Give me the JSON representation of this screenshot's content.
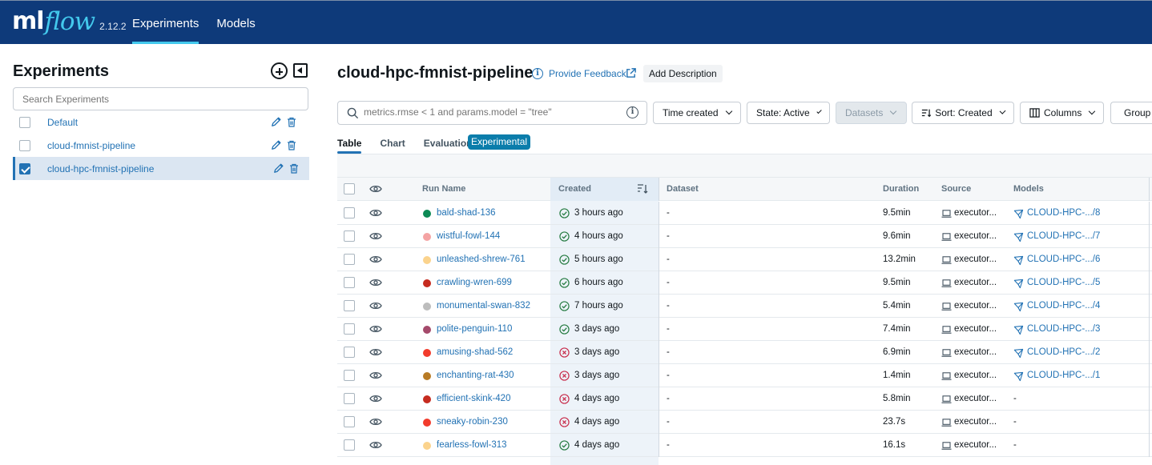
{
  "header": {
    "logo_ml": "ml",
    "logo_flow": "flow",
    "version": "2.12.2",
    "nav": [
      {
        "label": "Experiments",
        "active": true
      },
      {
        "label": "Models",
        "active": false
      }
    ],
    "bg_color": "#0e3a7a",
    "accent_color": "#43c9ed"
  },
  "sidebar": {
    "title": "Experiments",
    "search_placeholder": "Search Experiments",
    "items": [
      {
        "name": "Default",
        "selected": false
      },
      {
        "name": "cloud-fmnist-pipeline",
        "selected": false
      },
      {
        "name": "cloud-hpc-fmnist-pipeline",
        "selected": true
      }
    ]
  },
  "main": {
    "title": "cloud-hpc-fmnist-pipeline",
    "feedback_label": "Provide Feedback",
    "add_description_label": "Add Description",
    "filter_placeholder": "metrics.rmse < 1 and params.model = \"tree\"",
    "toolbar": {
      "time_created": "Time created",
      "state": "State: Active",
      "datasets": "Datasets",
      "sort": "Sort: Created",
      "columns": "Columns",
      "group": "Group"
    },
    "tabs": [
      {
        "label": "Table",
        "active": true
      },
      {
        "label": "Chart",
        "active": false
      },
      {
        "label": "Evaluation",
        "active": false
      }
    ],
    "experimental_badge": "Experimental"
  },
  "table": {
    "columns": {
      "run_name": "Run Name",
      "created": "Created",
      "dataset": "Dataset",
      "duration": "Duration",
      "source": "Source",
      "models": "Models"
    },
    "rows": [
      {
        "name": "bald-shad-136",
        "color": "#0c8a55",
        "status": "finished",
        "created": "3 hours ago",
        "dataset": "-",
        "duration": "9.5min",
        "source": "executor...",
        "model": "CLOUD-HPC-.../8"
      },
      {
        "name": "wistful-fowl-144",
        "color": "#f4a3a3",
        "status": "finished",
        "created": "4 hours ago",
        "dataset": "-",
        "duration": "9.6min",
        "source": "executor...",
        "model": "CLOUD-HPC-.../7"
      },
      {
        "name": "unleashed-shrew-761",
        "color": "#fbd38d",
        "status": "finished",
        "created": "5 hours ago",
        "dataset": "-",
        "duration": "13.2min",
        "source": "executor...",
        "model": "CLOUD-HPC-.../6"
      },
      {
        "name": "crawling-wren-699",
        "color": "#c62b1f",
        "status": "finished",
        "created": "6 hours ago",
        "dataset": "-",
        "duration": "9.5min",
        "source": "executor...",
        "model": "CLOUD-HPC-.../5"
      },
      {
        "name": "monumental-swan-832",
        "color": "#bdbdbd",
        "status": "finished",
        "created": "7 hours ago",
        "dataset": "-",
        "duration": "5.4min",
        "source": "executor...",
        "model": "CLOUD-HPC-.../4"
      },
      {
        "name": "polite-penguin-110",
        "color": "#a54a6b",
        "status": "finished",
        "created": "3 days ago",
        "dataset": "-",
        "duration": "7.4min",
        "source": "executor...",
        "model": "CLOUD-HPC-.../3"
      },
      {
        "name": "amusing-shad-562",
        "color": "#f23b2c",
        "status": "failed",
        "created": "3 days ago",
        "dataset": "-",
        "duration": "6.9min",
        "source": "executor...",
        "model": "CLOUD-HPC-.../2"
      },
      {
        "name": "enchanting-rat-430",
        "color": "#b87b25",
        "status": "failed",
        "created": "3 days ago",
        "dataset": "-",
        "duration": "1.4min",
        "source": "executor...",
        "model": "CLOUD-HPC-.../1"
      },
      {
        "name": "efficient-skink-420",
        "color": "#c62b1f",
        "status": "failed",
        "created": "4 days ago",
        "dataset": "-",
        "duration": "5.8min",
        "source": "executor...",
        "model": "-"
      },
      {
        "name": "sneaky-robin-230",
        "color": "#f23b2c",
        "status": "failed",
        "created": "4 days ago",
        "dataset": "-",
        "duration": "23.7s",
        "source": "executor...",
        "model": "-"
      },
      {
        "name": "fearless-fowl-313",
        "color": "#fbd38d",
        "status": "finished",
        "created": "4 days ago",
        "dataset": "-",
        "duration": "16.1s",
        "source": "executor...",
        "model": "-"
      }
    ]
  },
  "colors": {
    "link": "#2272b4",
    "success": "#277c43",
    "failure": "#c82d4c"
  }
}
